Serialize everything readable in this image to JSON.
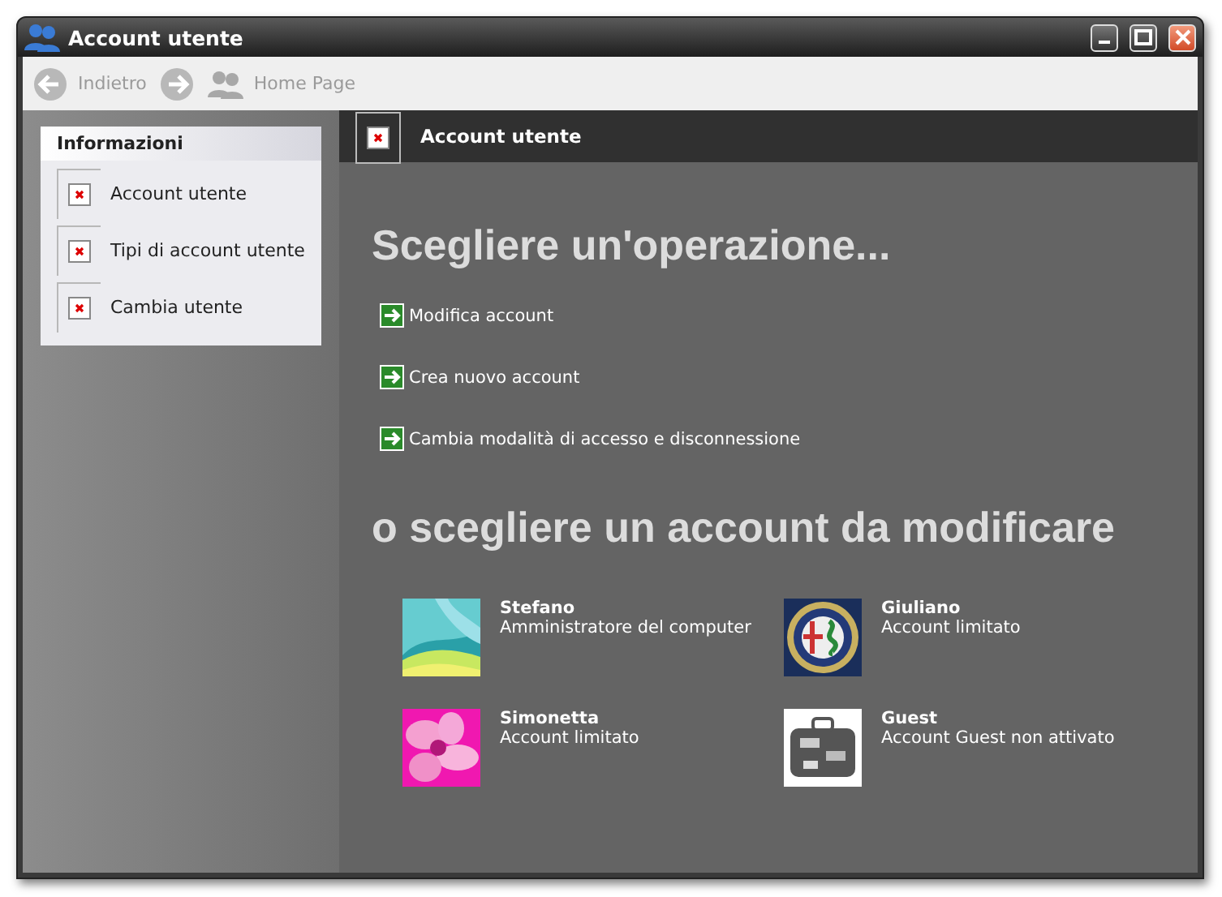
{
  "window": {
    "title": "Account utente"
  },
  "toolbar": [
    {
      "kind": "back",
      "label": "Indietro",
      "disabled": true
    },
    {
      "kind": "forward",
      "disabled": true
    },
    {
      "kind": "home",
      "label": "Home Page",
      "disabled": true
    }
  ],
  "sidebar": {
    "title": "Informazioni",
    "items": [
      "Account utente",
      "Tipi di account utente",
      "Cambia utente"
    ]
  },
  "header": {
    "title": "Account utente"
  },
  "tasks": {
    "heading": "Scegliere un'operazione...",
    "items": [
      "Modifica account",
      "Crea nuovo account",
      "Cambia modalità di accesso e disconnessione"
    ]
  },
  "accounts": {
    "heading": "o scegliere un account da modificare",
    "items": [
      {
        "name": "Stefano",
        "type": "Amministratore del computer"
      },
      {
        "name": "Giuliano",
        "type": "Account limitato"
      },
      {
        "name": "Simonetta",
        "type": "Account limitato"
      },
      {
        "name": "Guest",
        "type": "Account Guest non attivato"
      }
    ]
  }
}
